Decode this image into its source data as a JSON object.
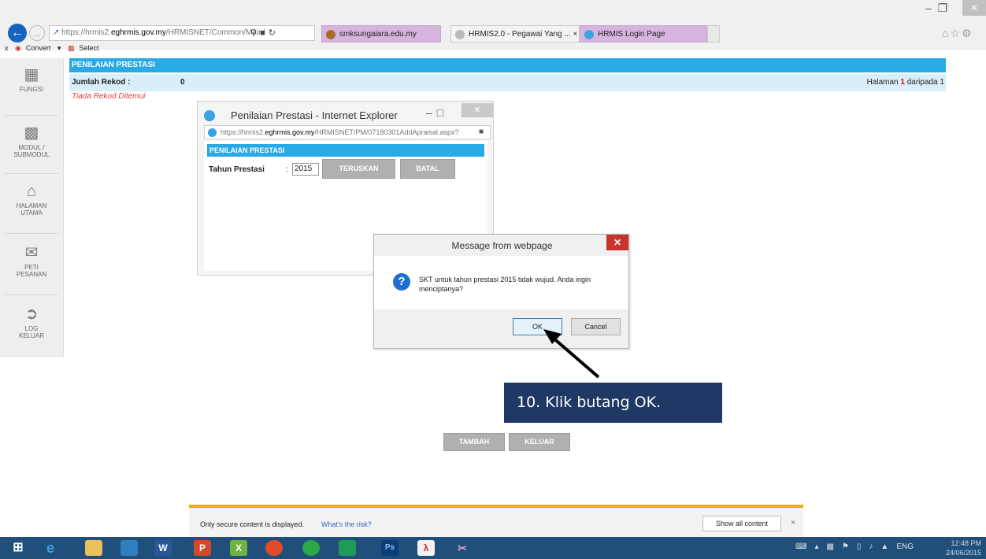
{
  "browser": {
    "address_host_prefix": "https://hrmis2.",
    "address_host": "eghrmis.gov.my",
    "address_path": "/HRMISNET/Common/Main/",
    "tabs": [
      {
        "label": "smksungaiara.edu.my"
      },
      {
        "label": "HRMIS2.0 - Pegawai Yang ...  ×"
      },
      {
        "label": "HRMIS Login Page"
      }
    ],
    "cmdbar": {
      "close": "x",
      "convert": "Convert",
      "select": "Select"
    }
  },
  "sidebar": {
    "items": [
      {
        "label": "FUNGSI",
        "icon": "grid-icon"
      },
      {
        "label": "MODUL /\nSUBMODUL",
        "icon": "tiles-icon"
      },
      {
        "label": "HALAMAN\nUTAMA",
        "icon": "home-icon"
      },
      {
        "label": "PETI\nPESANAN",
        "icon": "mail-icon"
      },
      {
        "label": "LOG\nKELUAR",
        "icon": "logout-icon"
      }
    ]
  },
  "page": {
    "title": "PENILAIAN PRESTASI",
    "record_label": "Jumlah Rekod :",
    "record_count": "0",
    "page_prefix": "Halaman ",
    "page_current": "1",
    "page_suffix": " daripada 1",
    "no_record": "Tiada Rekod Ditemui",
    "tambah": "TAMBAH",
    "keluar": "KELUAR"
  },
  "popup": {
    "title": "Penilaian Prestasi - Internet Explorer",
    "address_prefix": "https://hrmis2.",
    "address_host": "eghrmis.gov.my",
    "address_path": "/HRMISNET/PM/07180301AddApraisal.aspx?",
    "header": "PENILAIAN PRESTASI",
    "label": "Tahun Prestasi",
    "colon": ":",
    "year": "2015",
    "teruskan": "TERUSKAN",
    "batal": "BATAL"
  },
  "dialog": {
    "title": "Message from webpage",
    "message": "SKT untuk tahun prestasi 2015 tidak wujud. Anda ingin menciptanya?",
    "ok": "OK",
    "cancel": "Cancel"
  },
  "annotation": {
    "text": "10.  Klik butang OK."
  },
  "infobar": {
    "text": "Only secure content is displayed.",
    "link": "What's the risk?",
    "button": "Show all content",
    "close": "×"
  },
  "taskbar": {
    "time": "12:48 PM",
    "date": "24/06/2015",
    "lang": "ENG"
  },
  "colors": {
    "accent_blue": "#29a9e5",
    "callout_bg": "#1f3864",
    "info_bar_border": "#f0ad00"
  }
}
